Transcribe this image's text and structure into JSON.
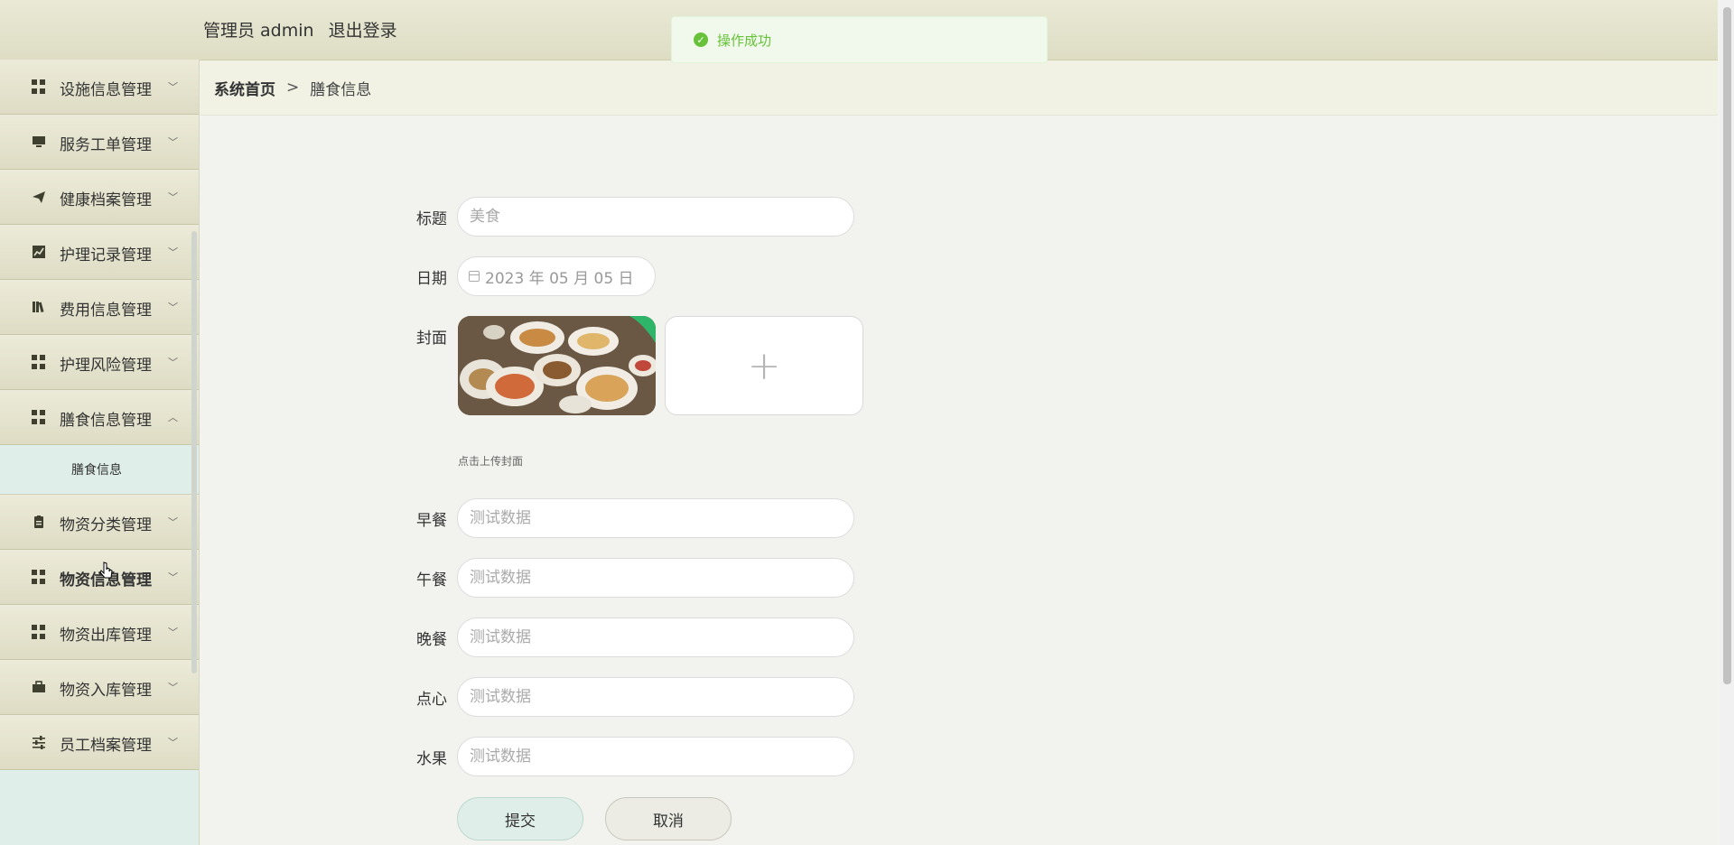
{
  "header": {
    "user_label": "管理员 admin",
    "logout_label": "退出登录"
  },
  "toast": {
    "message": "操作成功"
  },
  "sidebar": {
    "items": [
      {
        "label": "设施信息管理",
        "icon": "grid-icon"
      },
      {
        "label": "服务工单管理",
        "icon": "monitor-icon"
      },
      {
        "label": "健康档案管理",
        "icon": "send-icon"
      },
      {
        "label": "护理记录管理",
        "icon": "chart-icon"
      },
      {
        "label": "费用信息管理",
        "icon": "library-icon"
      },
      {
        "label": "护理风险管理",
        "icon": "grid-icon"
      },
      {
        "label": "膳食信息管理",
        "icon": "grid-icon",
        "expanded": true,
        "children": [
          {
            "label": "膳食信息"
          }
        ]
      },
      {
        "label": "物资分类管理",
        "icon": "clipboard-icon"
      },
      {
        "label": "物资信息管理",
        "icon": "grid-icon"
      },
      {
        "label": "物资出库管理",
        "icon": "grid-icon"
      },
      {
        "label": "物资入库管理",
        "icon": "briefcase-icon"
      },
      {
        "label": "员工档案管理",
        "icon": "sliders-icon"
      }
    ]
  },
  "breadcrumb": {
    "home": "系统首页",
    "separator": ">",
    "current": "膳食信息"
  },
  "form": {
    "title_label": "标题",
    "title_placeholder": "美食",
    "date_label": "日期",
    "date_value": "2023 年 05 月 05 日",
    "cover_label": "封面",
    "upload_tip": "点击上传封面",
    "breakfast_label": "早餐",
    "breakfast_placeholder": "测试数据",
    "lunch_label": "午餐",
    "lunch_placeholder": "测试数据",
    "dinner_label": "晚餐",
    "dinner_placeholder": "测试数据",
    "snack_label": "点心",
    "snack_placeholder": "测试数据",
    "fruit_label": "水果",
    "fruit_placeholder": "测试数据",
    "submit_label": "提交",
    "cancel_label": "取消"
  }
}
